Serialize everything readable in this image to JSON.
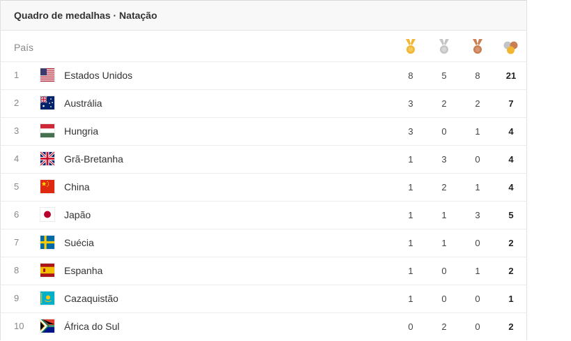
{
  "title": "Quadro de medalhas · Natação",
  "column_country": "País",
  "medal_icons": {
    "gold": "gold-medal-icon",
    "silver": "silver-medal-icon",
    "bronze": "bronze-medal-icon",
    "total": "total-medals-icon"
  },
  "colors": {
    "gold": "#f2b632",
    "silver": "#c0c0c0",
    "bronze": "#c87f52",
    "header_bg": "#f8f8f8"
  },
  "rows": [
    {
      "rank": "1",
      "country": "Estados Unidos",
      "flag": "us-flag-icon",
      "gold": "8",
      "silver": "5",
      "bronze": "8",
      "total": "21"
    },
    {
      "rank": "2",
      "country": "Austrália",
      "flag": "au-flag-icon",
      "gold": "3",
      "silver": "2",
      "bronze": "2",
      "total": "7"
    },
    {
      "rank": "3",
      "country": "Hungria",
      "flag": "hu-flag-icon",
      "gold": "3",
      "silver": "0",
      "bronze": "1",
      "total": "4"
    },
    {
      "rank": "4",
      "country": "Grã-Bretanha",
      "flag": "gb-flag-icon",
      "gold": "1",
      "silver": "3",
      "bronze": "0",
      "total": "4"
    },
    {
      "rank": "5",
      "country": "China",
      "flag": "cn-flag-icon",
      "gold": "1",
      "silver": "2",
      "bronze": "1",
      "total": "4"
    },
    {
      "rank": "6",
      "country": "Japão",
      "flag": "jp-flag-icon",
      "gold": "1",
      "silver": "1",
      "bronze": "3",
      "total": "5"
    },
    {
      "rank": "7",
      "country": "Suécia",
      "flag": "se-flag-icon",
      "gold": "1",
      "silver": "1",
      "bronze": "0",
      "total": "2"
    },
    {
      "rank": "8",
      "country": "Espanha",
      "flag": "es-flag-icon",
      "gold": "1",
      "silver": "0",
      "bronze": "1",
      "total": "2"
    },
    {
      "rank": "9",
      "country": "Cazaquistão",
      "flag": "kz-flag-icon",
      "gold": "1",
      "silver": "0",
      "bronze": "0",
      "total": "1"
    },
    {
      "rank": "10",
      "country": "África do Sul",
      "flag": "za-flag-icon",
      "gold": "0",
      "silver": "2",
      "bronze": "0",
      "total": "2"
    }
  ]
}
